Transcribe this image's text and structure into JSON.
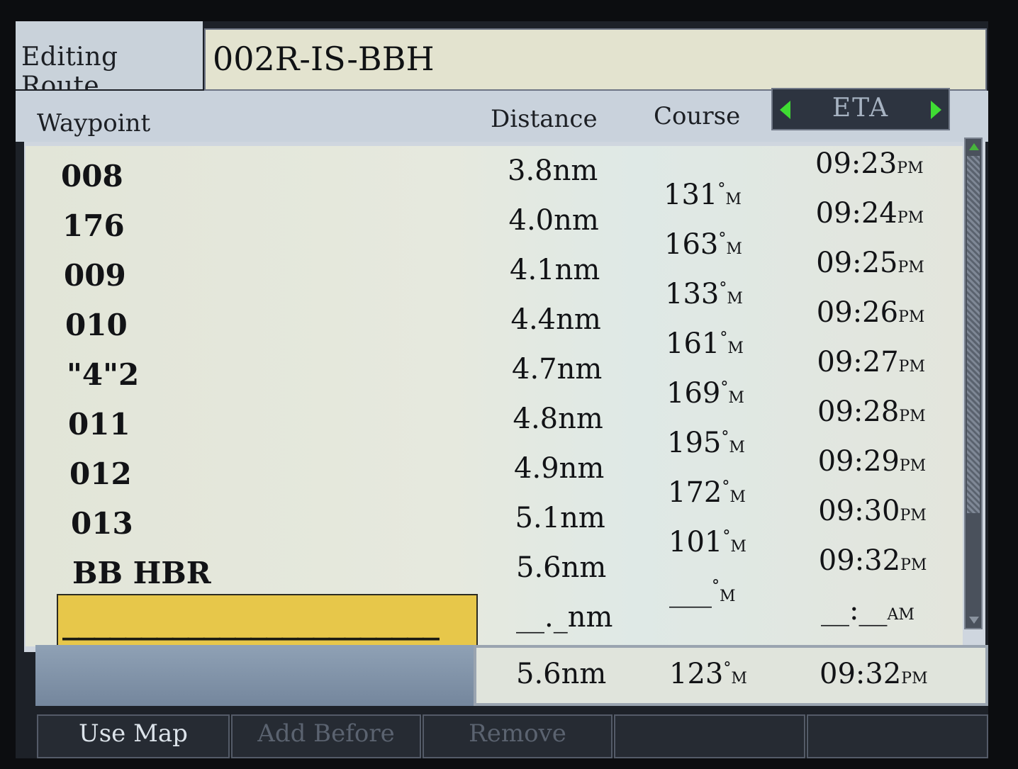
{
  "title": {
    "label": "Editing  Route",
    "route_name": "002R-IS-BBH"
  },
  "columns": {
    "waypoint": "Waypoint",
    "distance": "Distance",
    "course": "Course",
    "selector": "ETA"
  },
  "waypoints": [
    {
      "name": "008",
      "distance": "3.8nm",
      "eta_time": "09:23",
      "eta_ampm": "PM"
    },
    {
      "name": "176",
      "distance": "4.0nm",
      "eta_time": "09:24",
      "eta_ampm": "PM"
    },
    {
      "name": "009",
      "distance": "4.1nm",
      "eta_time": "09:25",
      "eta_ampm": "PM"
    },
    {
      "name": "010",
      "distance": "4.4nm",
      "eta_time": "09:26",
      "eta_ampm": "PM"
    },
    {
      "name": "\"4\"2",
      "distance": "4.7nm",
      "eta_time": "09:27",
      "eta_ampm": "PM"
    },
    {
      "name": "011",
      "distance": "4.8nm",
      "eta_time": "09:28",
      "eta_ampm": "PM"
    },
    {
      "name": "012",
      "distance": "4.9nm",
      "eta_time": "09:29",
      "eta_ampm": "PM"
    },
    {
      "name": "013",
      "distance": "5.1nm",
      "eta_time": "09:30",
      "eta_ampm": "PM"
    },
    {
      "name": "BB HBR",
      "distance": "5.6nm",
      "eta_time": "09:32",
      "eta_ampm": "PM"
    }
  ],
  "courses": [
    {
      "value": "131",
      "unit": "M"
    },
    {
      "value": "163",
      "unit": "M"
    },
    {
      "value": "133",
      "unit": "M"
    },
    {
      "value": "161",
      "unit": "M"
    },
    {
      "value": "169",
      "unit": "M"
    },
    {
      "value": "195",
      "unit": "M"
    },
    {
      "value": "172",
      "unit": "M"
    },
    {
      "value": "101",
      "unit": "M"
    },
    {
      "value": "___",
      "unit": "M"
    }
  ],
  "new_entry": {
    "placeholder": "________________________",
    "distance": "__._nm",
    "eta_time": "__:__",
    "eta_ampm": "AM"
  },
  "totals": {
    "distance": "5.6nm",
    "course": "123",
    "course_unit": "M",
    "eta_time": "09:32",
    "eta_ampm": "PM"
  },
  "softkeys": [
    {
      "label": "Use Map",
      "enabled": true
    },
    {
      "label": "Add Before",
      "enabled": false
    },
    {
      "label": "Remove",
      "enabled": false
    },
    {
      "label": "",
      "enabled": false
    },
    {
      "label": "",
      "enabled": false
    }
  ],
  "colors": {
    "screen_bg": "#1d2128",
    "list_bg": "#e4e7dc",
    "highlight": "#e7c74a",
    "arrow_green": "#3fdc33",
    "softkey_enabled_text": "#dce3ea",
    "softkey_disabled_text": "#5b6370"
  }
}
